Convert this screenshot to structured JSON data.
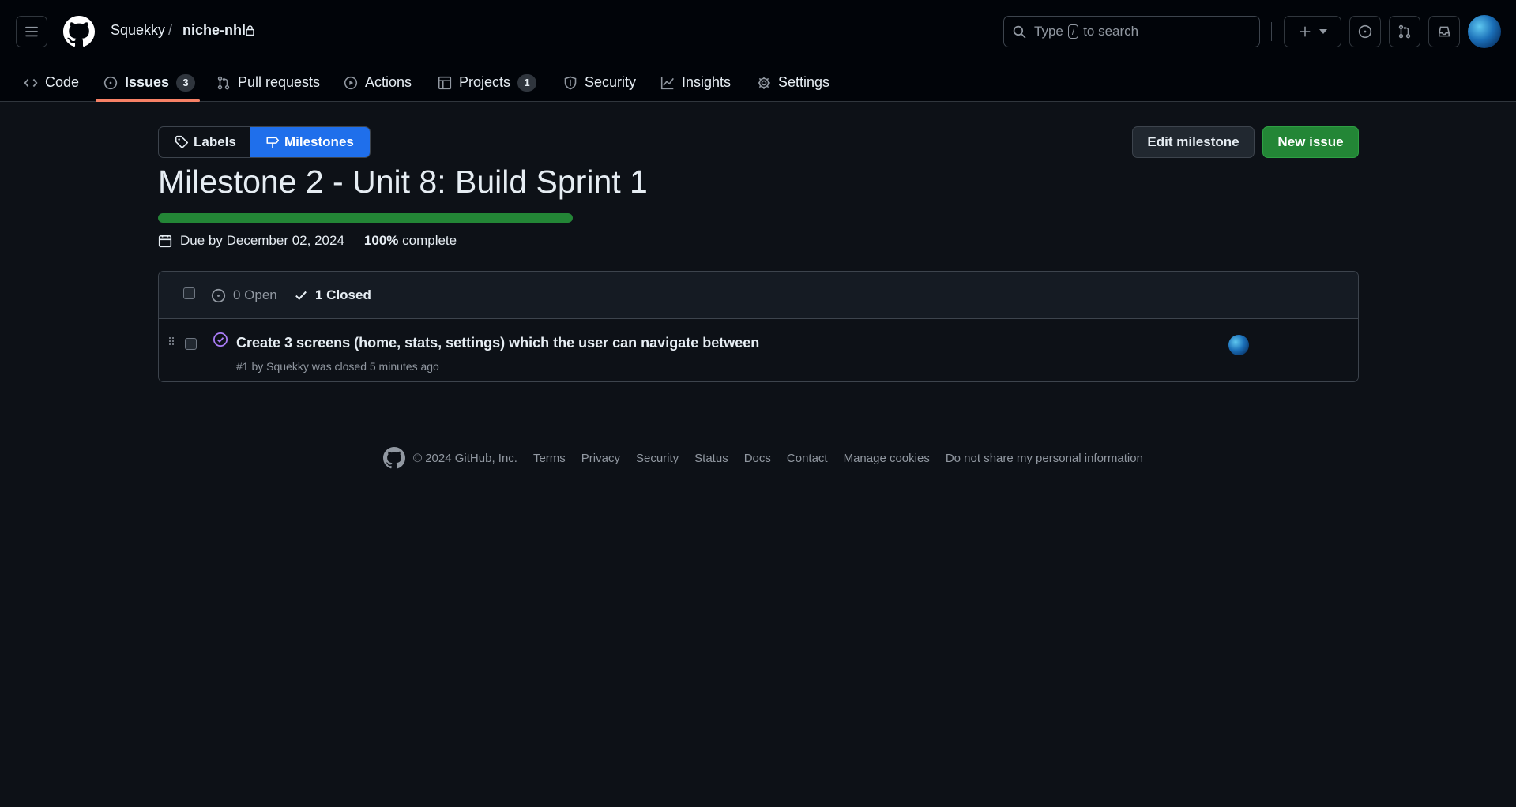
{
  "header": {
    "owner": "Squekky",
    "separator": "/",
    "repo": "niche-nhl",
    "search_text_before": "Type",
    "search_key": "/",
    "search_text_after": "to search"
  },
  "nav": {
    "items": [
      {
        "label": "Code",
        "icon": "code-icon"
      },
      {
        "label": "Issues",
        "icon": "issue-opened-icon",
        "count": "3",
        "active": true
      },
      {
        "label": "Pull requests",
        "icon": "git-pull-request-icon"
      },
      {
        "label": "Actions",
        "icon": "play-icon"
      },
      {
        "label": "Projects",
        "icon": "table-icon",
        "count": "1"
      },
      {
        "label": "Security",
        "icon": "shield-icon"
      },
      {
        "label": "Insights",
        "icon": "graph-icon"
      },
      {
        "label": "Settings",
        "icon": "gear-icon"
      }
    ]
  },
  "toolbar": {
    "labels_label": "Labels",
    "milestones_label": "Milestones",
    "edit_label": "Edit milestone",
    "new_issue_label": "New issue"
  },
  "milestone": {
    "title": "Milestone 2 - Unit 8: Build Sprint 1",
    "progress": 1.0,
    "due_text": "Due by December 02, 2024",
    "percent_text": "100%",
    "complete_text": "complete"
  },
  "issues": {
    "open_label": "0 Open",
    "closed_label": "1 Closed",
    "rows": [
      {
        "title": "Create 3 screens (home, stats, settings) which the user can navigate between",
        "subtitle": "#1 by Squekky was closed 5 minutes ago"
      }
    ]
  },
  "footer": {
    "copyright": "© 2024 GitHub, Inc.",
    "links": [
      "Terms",
      "Privacy",
      "Security",
      "Status",
      "Docs",
      "Contact",
      "Manage cookies",
      "Do not share my personal information"
    ]
  },
  "colors": {
    "background": "#0d1117",
    "header": "#010409",
    "accent_blue": "#1f6feb",
    "green": "#238636",
    "closed_purple": "#ab7df8",
    "underline": "#f78166"
  }
}
